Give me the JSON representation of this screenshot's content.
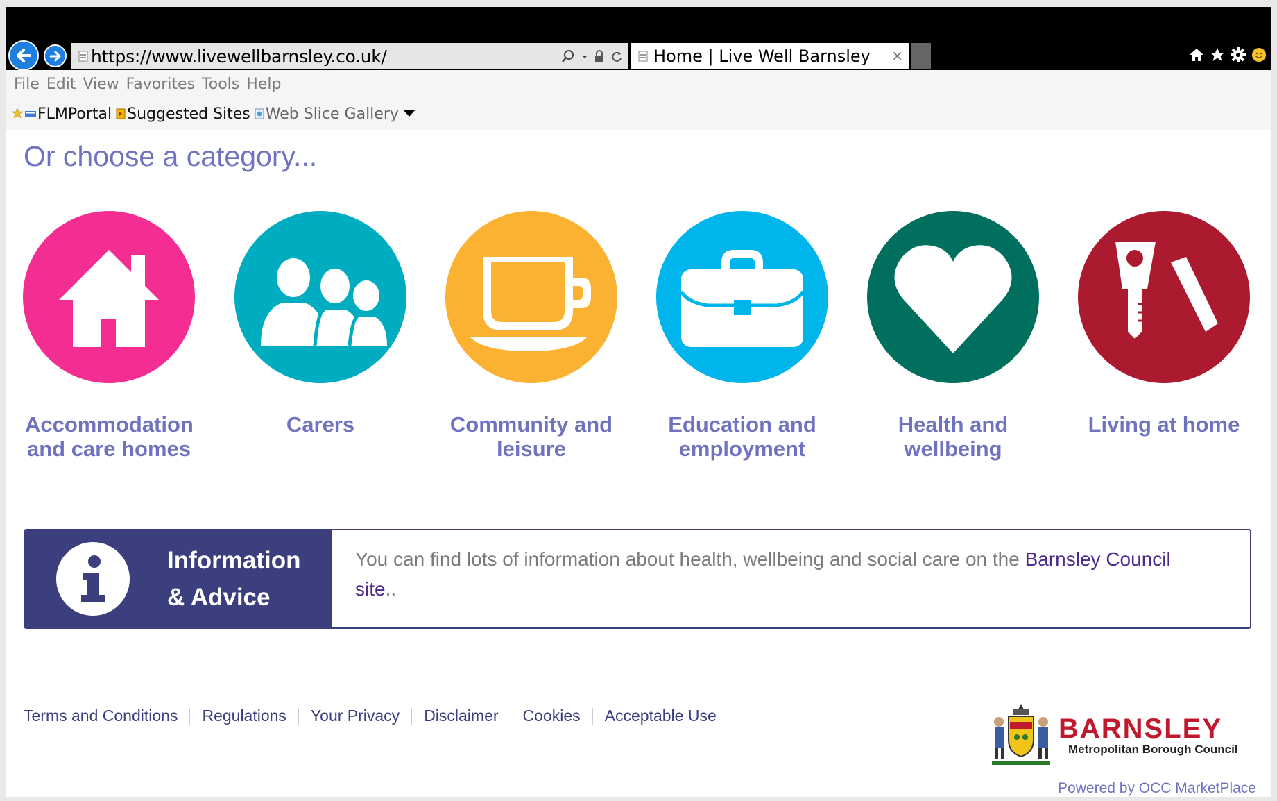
{
  "browser": {
    "url": "https://www.livewellbarnsley.co.uk/",
    "tab_title": "Home | Live Well Barnsley",
    "tab_close": "×",
    "menu": [
      "File",
      "Edit",
      "View",
      "Favorites",
      "Tools",
      "Help"
    ],
    "favorites": [
      "FLMPortal",
      "Suggested Sites",
      "Web Slice Gallery"
    ]
  },
  "page": {
    "heading": "Or choose a category...",
    "categories": [
      {
        "label": "Accommodation and care homes",
        "color": "#f42d93",
        "icon": "house-icon"
      },
      {
        "label": "Carers",
        "color": "#00adc0",
        "icon": "people-icon"
      },
      {
        "label": "Community and leisure",
        "color": "#fbb232",
        "icon": "cup-icon"
      },
      {
        "label": "Education and employment",
        "color": "#00b4ec",
        "icon": "briefcase-icon"
      },
      {
        "label": "Health and wellbeing",
        "color": "#006f5d",
        "icon": "heart-icon"
      },
      {
        "label": "Living at home",
        "color": "#ac1a2f",
        "icon": "key-icon"
      }
    ],
    "info": {
      "title_line1": "Information",
      "title_line2": "& Advice",
      "text": "You can find lots of information about health, wellbeing and social care on the ",
      "link": "Barnsley Council site",
      "suffix": ".."
    },
    "footer": {
      "links": [
        "Terms and Conditions",
        "Regulations",
        "Your Privacy",
        "Disclaimer",
        "Cookies",
        "Acceptable Use"
      ],
      "council_name": "BARNSLEY",
      "council_sub": "Metropolitan Borough Council",
      "powered_by": "Powered by OCC MarketPlace"
    }
  }
}
